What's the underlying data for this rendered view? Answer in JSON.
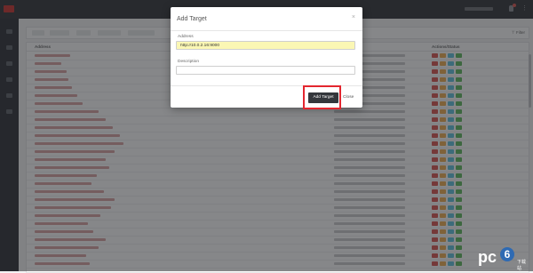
{
  "dialog": {
    "title": "Add Target",
    "close_glyph": "×",
    "address_label": "Address",
    "address_value": "http://10.0.2.16:9000",
    "description_label": "Description",
    "description_value": "",
    "add_button": "Add Target",
    "close_button": "Close"
  },
  "table": {
    "address_header": "Address",
    "actions_header": "Actions/Status"
  },
  "toolbar": {
    "filter_label": "Filter"
  },
  "colors": {
    "accent_red": "#e3262f",
    "topbar": "#2f3236",
    "action_red": "#d9534f",
    "action_orange": "#f0ad4e",
    "action_blue": "#5bc0de",
    "action_green": "#5cb85c"
  },
  "watermark": {
    "text": "pc",
    "circle": "6",
    "sub": "下载站"
  }
}
